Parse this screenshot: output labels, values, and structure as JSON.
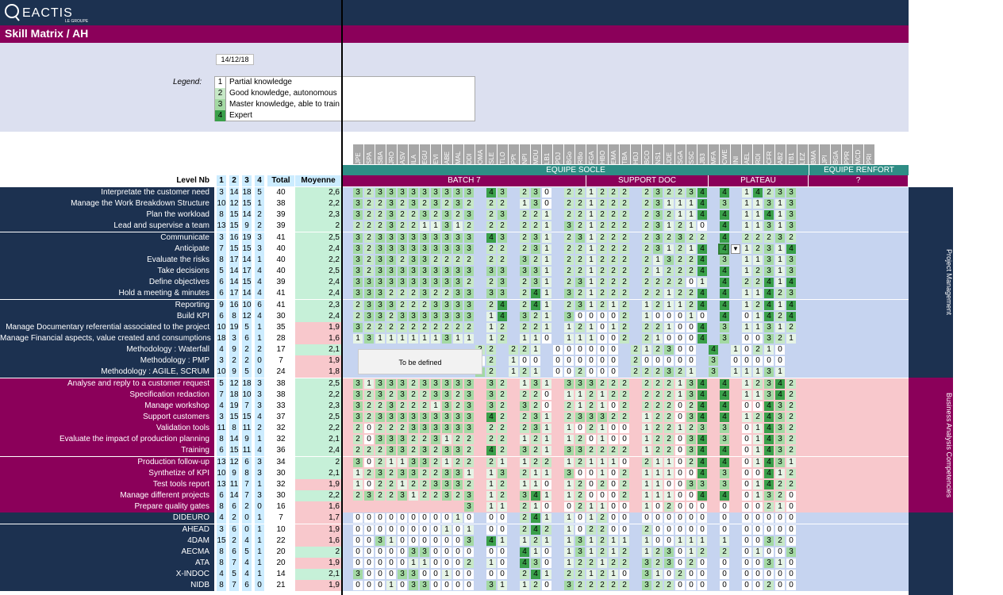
{
  "brand": {
    "name": "REACTIS",
    "tagline": "LE GROUPE"
  },
  "title": "Skill Matrix / AH",
  "date": "14/12/18",
  "legend": {
    "label": "Legend:",
    "items": [
      {
        "n": "1",
        "text": "Partial knowledge"
      },
      {
        "n": "2",
        "text": "Good knowledge, autonomous"
      },
      {
        "n": "3",
        "text": "Master knowledge, able to train"
      },
      {
        "n": "4",
        "text": "Expert"
      }
    ]
  },
  "colors": {
    "navy": "#1c3150",
    "purple": "#8b005a",
    "teal": "#2e8d85",
    "l1": "#e6f4e6",
    "l2": "#c6e8c6",
    "l3": "#a3d9a3",
    "l4": "#3aa04a",
    "blue": "#c6d4f0",
    "pink": "#f8c8cc"
  },
  "header": {
    "level_nb": "Level Nb",
    "levels": [
      "1",
      "2",
      "3",
      "4"
    ],
    "total": "Total",
    "moyenne": "Moyenne"
  },
  "columns": [
    "JPE",
    "SPA",
    "SBA",
    "JRO",
    "ASV",
    "ILA",
    "EGU",
    "EVI",
    "ABE",
    "MAL",
    "DDI",
    "OMA",
    "SLE",
    "TLO",
    "PPt",
    "NPI",
    "MDU",
    "LB1",
    "PDJ",
    "BGo",
    "RBo",
    "FGA",
    "HBO",
    "EMA",
    "TBA",
    "HDJ",
    "BCO",
    "NS1",
    "JDE",
    "SGA",
    "SSC",
    "JB3",
    "MFA",
    "CWE",
    "INI",
    "AEL",
    "RDI",
    "CFR",
    "AB2",
    "TB1",
    "LEZ",
    "BMA",
    "JPI",
    "BGA",
    "PPR",
    "MCD",
    "PRI"
  ],
  "groups": [
    {
      "label": "EQUIPE SOCLE"
    },
    {
      "label": "EQUIPE RENFORT"
    }
  ],
  "subgroups": [
    {
      "label": "BATCH 7"
    },
    {
      "label": "SUPPORT DOC"
    },
    {
      "label": "PLATEAU"
    },
    {
      "label": "?"
    }
  ],
  "sections": [
    {
      "label": "Project Management"
    },
    {
      "label": "Business Analysis Competencies"
    }
  ],
  "to_be_defined": "To be defined",
  "rows": [
    {
      "label": "Interpretate the customer need",
      "lv": [
        "3",
        "14",
        "18",
        "5"
      ],
      "total": "40",
      "moy": "2,6",
      "sec": 0,
      "cells": "32333333333 43 230 221222 232234 4 14233"
    },
    {
      "label": "Manage the Work Breakdown Structure",
      "lv": [
        "10",
        "12",
        "15",
        "1"
      ],
      "total": "38",
      "moy": "2,2",
      "sec": 0,
      "cells": "32232323232 22 130 221222 231114 3 11313"
    },
    {
      "label": "Plan the workload",
      "lv": [
        "8",
        "15",
        "14",
        "2"
      ],
      "total": "39",
      "moy": "2,3",
      "sec": 0,
      "cells": "32232232323 23 221 221222 232114 4 11413"
    },
    {
      "label": "Lead and supervise a team",
      "lv": [
        "13",
        "15",
        "9",
        "2"
      ],
      "total": "39",
      "moy": "2",
      "sec": 0,
      "cells": "22232211312 22 221 321222 231210 4 11313"
    },
    {
      "label": "Communicate",
      "lv": [
        "3",
        "16",
        "19",
        "3"
      ],
      "total": "41",
      "moy": "2,5",
      "sec": 0,
      "cells": "32333333333 43 231 231222 232322 4 22232"
    },
    {
      "label": "Anticipate",
      "lv": [
        "7",
        "15",
        "15",
        "3"
      ],
      "total": "40",
      "moy": "2,4",
      "sec": 0,
      "cells": "32333333333 22 231 221222 231214 4 12314"
    },
    {
      "label": "Evaluate the risks",
      "lv": [
        "8",
        "17",
        "14",
        "1"
      ],
      "total": "40",
      "moy": "2,2",
      "sec": 0,
      "cells": "32332332222 22 321 221222 213224 3 11313"
    },
    {
      "label": "Take decisions",
      "lv": [
        "5",
        "14",
        "17",
        "4"
      ],
      "total": "40",
      "moy": "2,5",
      "sec": 0,
      "cells": "32333333333 33 331 221222 212224 4 12313"
    },
    {
      "label": "Define objectives",
      "lv": [
        "6",
        "14",
        "15",
        "4"
      ],
      "total": "39",
      "moy": "2,4",
      "sec": 0,
      "cells": "33333333332 23 231 231222 222201 4 22414"
    },
    {
      "label": "Hold a meeting & minutes",
      "lv": [
        "6",
        "17",
        "14",
        "4"
      ],
      "total": "41",
      "moy": "2,4",
      "sec": 0,
      "cells": "33322232233 33 241 321222 221224 4 11423"
    },
    {
      "label": "Reporting",
      "lv": [
        "9",
        "16",
        "10",
        "6"
      ],
      "total": "41",
      "moy": "2,3",
      "sec": 0,
      "cells": "23332223333 24 241 231212 121124 4 12414"
    },
    {
      "label": "Build KPI",
      "lv": [
        "6",
        "8",
        "12",
        "4"
      ],
      "total": "30",
      "moy": "2,4",
      "sec": 0,
      "cells": "23323333333 14 321 300002 100010 4 01424"
    },
    {
      "label": "Manage Documentary referential associated to the project",
      "lv": [
        "10",
        "19",
        "5",
        "1"
      ],
      "total": "35",
      "moy": "1,9",
      "sec": 0,
      "cells": "32222222222 12 221 121012 221004 3 11312"
    },
    {
      "label": "Manage Financial aspects, value created and consumptions",
      "lv": [
        "18",
        "3",
        "6",
        "1"
      ],
      "total": "28",
      "moy": "1,6",
      "sec": 0,
      "cells": "13111111311 12 110 111002 210004 3 00321"
    },
    {
      "label": "Methodology : Waterfall",
      "lv": [
        "4",
        "9",
        "2",
        "2"
      ],
      "total": "17",
      "moy": "2,1",
      "sec": 0,
      "cells": "           22 221 000000 212300 4 10210"
    },
    {
      "label": "Methodology : PMP",
      "lv": [
        "3",
        "2",
        "2",
        "0"
      ],
      "total": "7",
      "moy": "1,9",
      "sec": 0,
      "cells": "           02 100 000000 200000 3 00000"
    },
    {
      "label": "Methodology : AGILE, SCRUM",
      "lv": [
        "10",
        "9",
        "5",
        "0"
      ],
      "total": "24",
      "moy": "1,8",
      "sec": 0,
      "cells": "           32 121 002000 222321 3 11131"
    },
    {
      "label": "Analyse and reply to a customer request",
      "lv": [
        "5",
        "12",
        "18",
        "3"
      ],
      "total": "38",
      "moy": "2,5",
      "sec": 1,
      "cells": "31333233333 32 131 333222 222134 4 12342"
    },
    {
      "label": "Specification redaction",
      "lv": [
        "7",
        "18",
        "10",
        "3"
      ],
      "total": "38",
      "moy": "2,2",
      "sec": 1,
      "cells": "32323223323 32 220 112122 222134 4 11342"
    },
    {
      "label": "Manage workshop",
      "lv": [
        "4",
        "19",
        "7",
        "3"
      ],
      "total": "33",
      "moy": "2,3",
      "sec": 1,
      "cells": "32232221323 32 320 212102 222024 4 00432"
    },
    {
      "label": "Support customers",
      "lv": [
        "3",
        "15",
        "15",
        "4"
      ],
      "total": "37",
      "moy": "2,5",
      "sec": 1,
      "cells": "32333333333 42 231 233322 122034 4 12432"
    },
    {
      "label": "Validation tools",
      "lv": [
        "11",
        "8",
        "11",
        "2"
      ],
      "total": "32",
      "moy": "2,2",
      "sec": 1,
      "cells": "20222333333 22 231 102100 122123 3 01432"
    },
    {
      "label": "Evaluate the impact of production planning",
      "lv": [
        "8",
        "14",
        "9",
        "1"
      ],
      "total": "32",
      "moy": "2,1",
      "sec": 1,
      "cells": "20333223122 22 121 120100 122034 3 01432"
    },
    {
      "label": "Training",
      "lv": [
        "6",
        "15",
        "11",
        "4"
      ],
      "total": "36",
      "moy": "2,4",
      "sec": 1,
      "cells": "22233232332 42 321 332222 122034 4 01432"
    },
    {
      "label": "Production follow-up",
      "lv": [
        "13",
        "12",
        "6",
        "3"
      ],
      "total": "34",
      "moy": "2",
      "sec": 1,
      "cells": "30211332122 21 122 121110 211024 4 01431"
    },
    {
      "label": "Synthetize of KPI",
      "lv": [
        "10",
        "9",
        "8",
        "3"
      ],
      "total": "30",
      "moy": "2,1",
      "sec": 1,
      "cells": "12323322331 13 211 300102 111004 3 00412"
    },
    {
      "label": "Test tools report",
      "lv": [
        "13",
        "11",
        "7",
        "1"
      ],
      "total": "32",
      "moy": "1,9",
      "sec": 1,
      "cells": "10221223332 12 110 120202 110033 3 01422"
    },
    {
      "label": "Manage different projects",
      "lv": [
        "6",
        "14",
        "7",
        "3"
      ],
      "total": "30",
      "moy": "2,2",
      "sec": 1,
      "cells": "23223122323 12 341 120002 111004 4 01320"
    },
    {
      "label": "Prepare quality gates",
      "lv": [
        "8",
        "6",
        "2",
        "0"
      ],
      "total": "16",
      "moy": "1,6",
      "sec": 1,
      "cells": "          3 11 210 021100 102000 0 00210"
    },
    {
      "label": "DIDEURO",
      "lv": [
        "4",
        "2",
        "0",
        "1"
      ],
      "total": "7",
      "moy": "1,7",
      "sec": 2,
      "cells": "00000000010 00 241 101200 000000 0 00000"
    },
    {
      "label": "AHEAD",
      "lv": [
        "3",
        "6",
        "0",
        "1"
      ],
      "total": "10",
      "moy": "1,9",
      "sec": 2,
      "cells": "00000000101 00 242 102200 200000 0 00000"
    },
    {
      "label": "4DAM",
      "lv": [
        "15",
        "2",
        "4",
        "1"
      ],
      "total": "22",
      "moy": "1,6",
      "sec": 2,
      "cells": "00310000003 41 121 131211 100111 1 00320"
    },
    {
      "label": "AECMA",
      "lv": [
        "8",
        "6",
        "5",
        "1"
      ],
      "total": "20",
      "moy": "2",
      "sec": 2,
      "cells": "00000330000 00 410 131212 123012 2 01003"
    },
    {
      "label": "ATA",
      "lv": [
        "8",
        "7",
        "4",
        "1"
      ],
      "total": "20",
      "moy": "1,9",
      "sec": 2,
      "cells": "00000110002 10 430 122122 323020 0 00310"
    },
    {
      "label": "X-INDOC",
      "lv": [
        "4",
        "5",
        "4",
        "1"
      ],
      "total": "14",
      "moy": "2,1",
      "sec": 2,
      "cells": "30003300100 00 241 221210 310200 0 00000"
    },
    {
      "label": "NIDB",
      "lv": [
        "8",
        "7",
        "6",
        "0"
      ],
      "total": "21",
      "moy": "1,9",
      "sec": 2,
      "cells": "00010330000 31 120 322222 322000 0 00200"
    }
  ]
}
